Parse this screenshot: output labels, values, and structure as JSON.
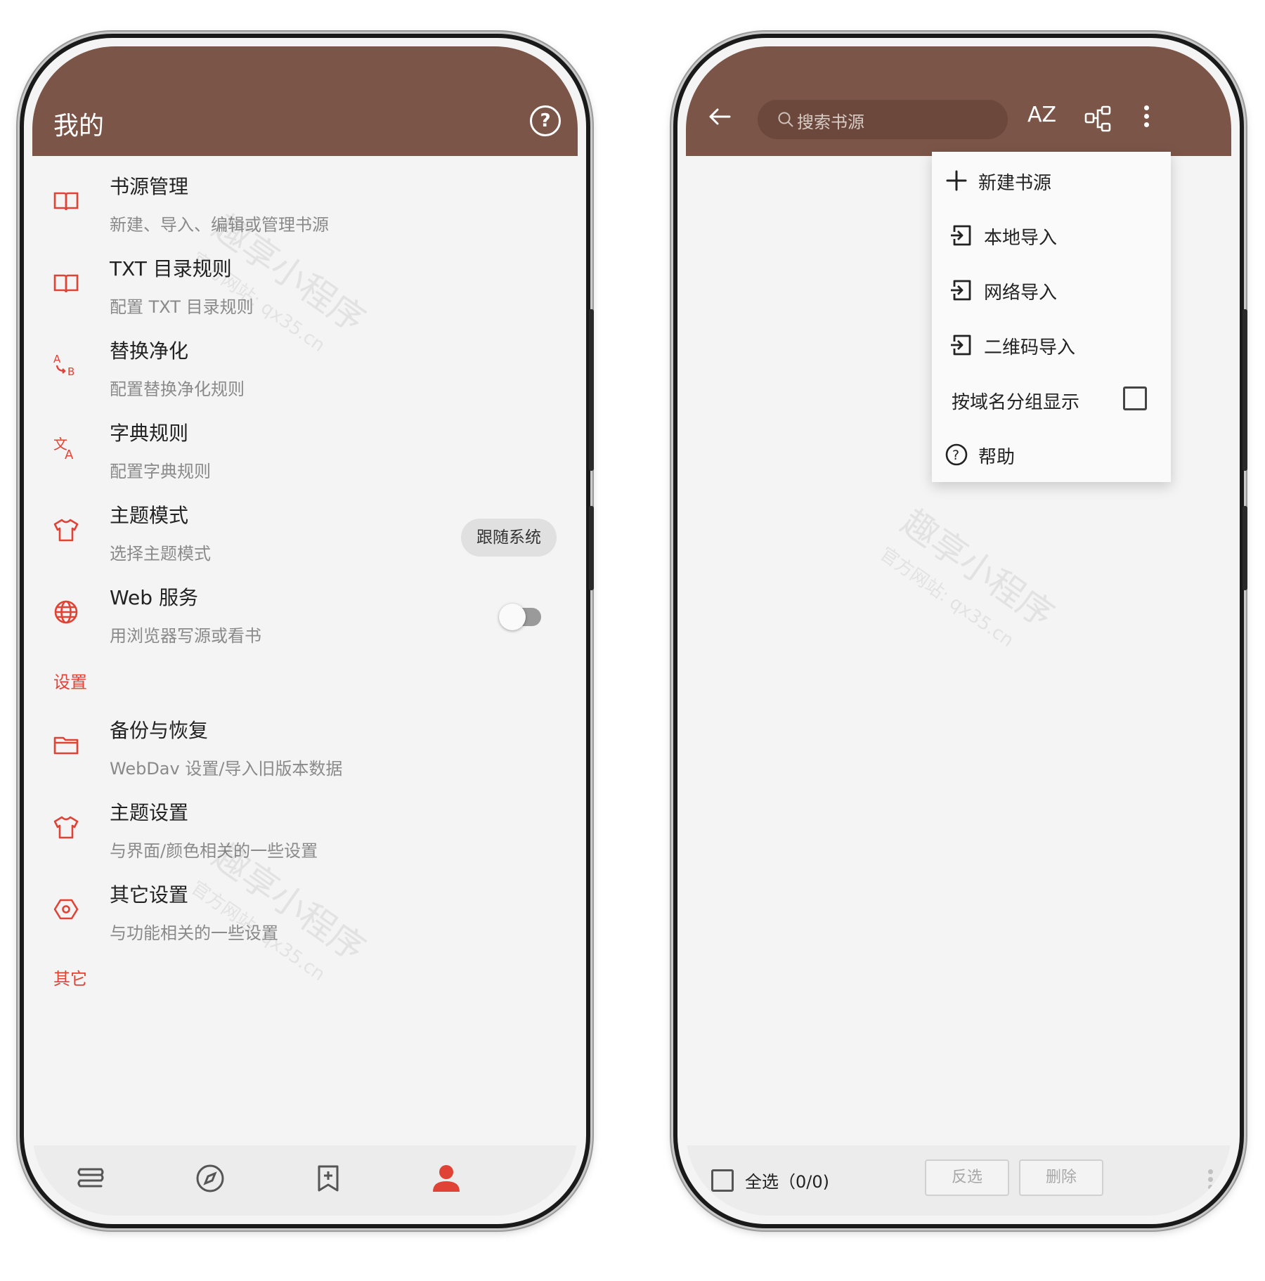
{
  "left_screen": {
    "title": "我的",
    "items": [
      {
        "title": "书源管理",
        "subtitle": "新建、导入、编辑或管理书源",
        "icon": "book-open-icon"
      },
      {
        "title": "TXT 目录规则",
        "subtitle": "配置 TXT 目录规则",
        "icon": "book-open-icon"
      },
      {
        "title": "替换净化",
        "subtitle": "配置替换净化规则",
        "icon": "replace-ab-icon"
      },
      {
        "title": "字典规则",
        "subtitle": "配置字典规则",
        "icon": "translate-icon"
      },
      {
        "title": "主题模式",
        "subtitle": "选择主题模式",
        "icon": "shirt-icon",
        "value": "跟随系统"
      },
      {
        "title": "Web 服务",
        "subtitle": "用浏览器写源或看书",
        "icon": "globe-icon",
        "toggle": false
      }
    ],
    "section_settings": "设置",
    "settings_items": [
      {
        "title": "备份与恢复",
        "subtitle": "WebDav 设置/导入旧版本数据",
        "icon": "folder-icon"
      },
      {
        "title": "主题设置",
        "subtitle": "与界面/颜色相关的一些设置",
        "icon": "shirt-icon"
      },
      {
        "title": "其它设置",
        "subtitle": "与功能相关的一些设置",
        "icon": "hex-gear-icon"
      }
    ],
    "section_other": "其它",
    "bottom_nav": [
      "bookshelf-icon",
      "compass-icon",
      "bookmark-add-icon",
      "person-icon"
    ]
  },
  "right_screen": {
    "search_placeholder": "搜索书源",
    "sort_label": "AZ",
    "menu": [
      {
        "label": "新建书源",
        "icon": "plus-icon"
      },
      {
        "label": "本地导入",
        "icon": "import-icon"
      },
      {
        "label": "网络导入",
        "icon": "import-icon"
      },
      {
        "label": "二维码导入",
        "icon": "import-icon"
      },
      {
        "label": "按域名分组显示",
        "checked": false
      },
      {
        "label": "帮助",
        "icon": "help-circle-icon"
      }
    ],
    "select_all": "全选（0/0)",
    "invert_label": "反选",
    "delete_label": "删除"
  },
  "watermark": {
    "line1": "趣享小程序",
    "line2": "官方网站: qx35.cn"
  },
  "colors": {
    "toolbar": "#7b5548",
    "accent": "#e04336",
    "background": "#f4f4f4"
  }
}
